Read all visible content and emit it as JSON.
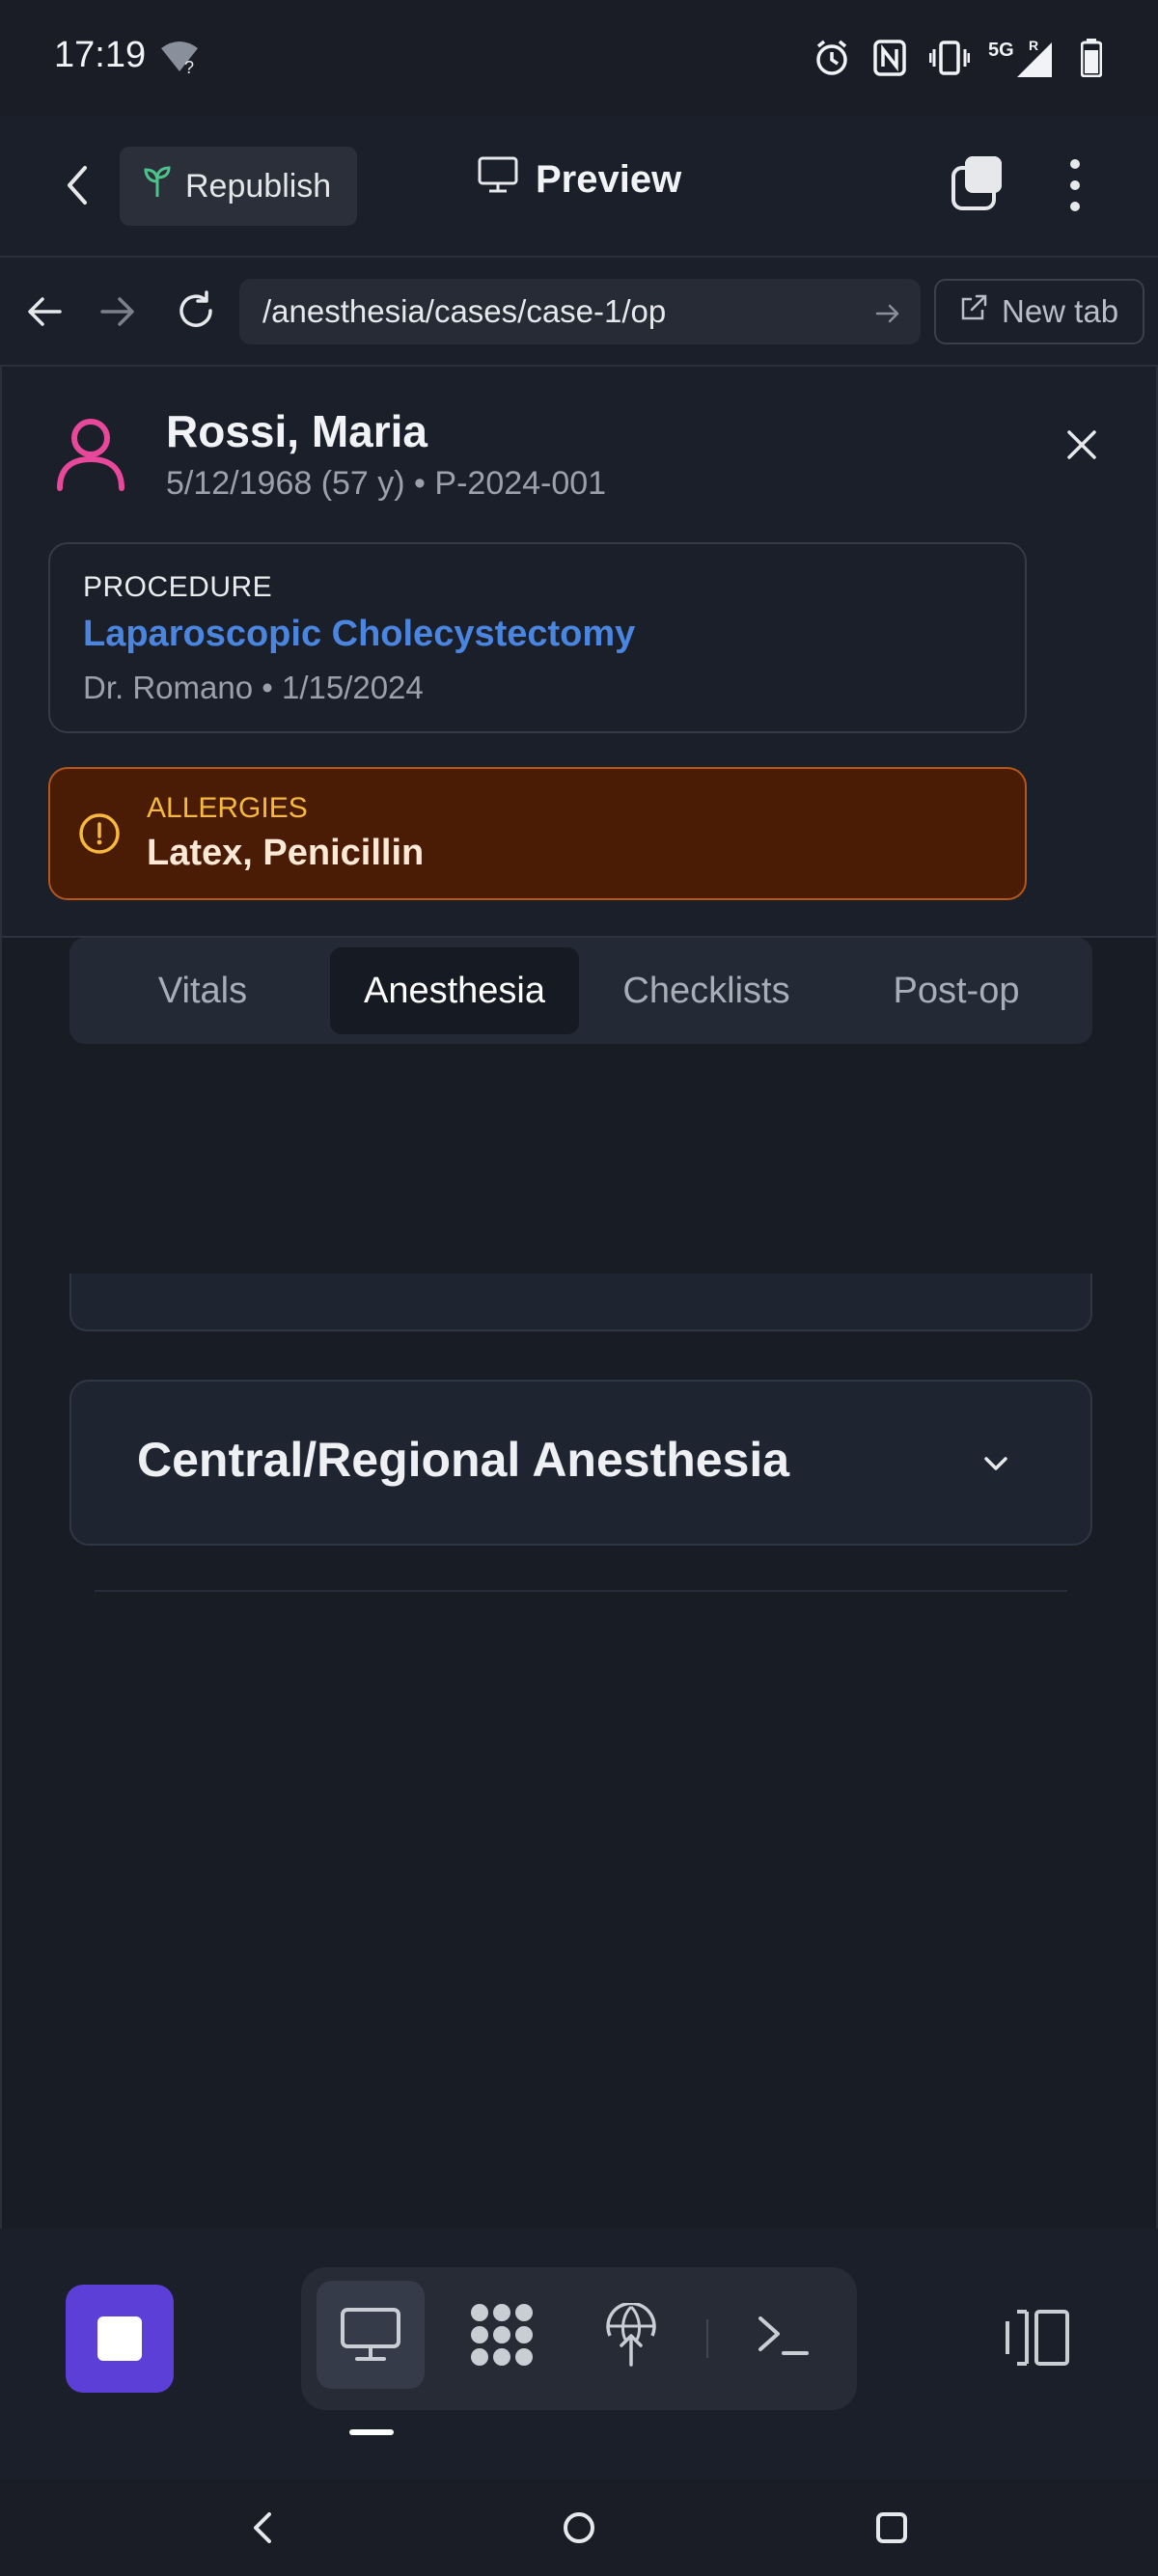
{
  "status_bar": {
    "time": "17:19",
    "network": "5G",
    "roaming": "R"
  },
  "app_bar": {
    "republish_label": "Republish",
    "preview_label": "Preview"
  },
  "browser": {
    "url": "/anesthesia/cases/case-1/op",
    "new_tab_label": "New tab"
  },
  "patient": {
    "name": "Rossi, Maria",
    "meta": "5/12/1968 (57 y) • P-2024-001"
  },
  "procedure": {
    "label": "PROCEDURE",
    "name": "Laparoscopic Cholecystectomy",
    "meta": "Dr. Romano • 1/15/2024"
  },
  "allergies": {
    "label": "ALLERGIES",
    "value": "Latex, Penicillin"
  },
  "tabs": [
    {
      "label": "Vitals"
    },
    {
      "label": "Anesthesia",
      "active": true
    },
    {
      "label": "Checklists"
    },
    {
      "label": "Post-op"
    }
  ],
  "sections": {
    "regional_title": "Central/Regional Anesthesia"
  },
  "colors": {
    "accent_blue": "#4a85e0",
    "allergy_bg": "#4a1b05",
    "allergy_label": "#f6b93b",
    "stop_button": "#5b3fd6",
    "patient_icon": "#e8489a"
  },
  "icons": {
    "republish": "sprout-icon",
    "preview": "monitor-icon"
  }
}
